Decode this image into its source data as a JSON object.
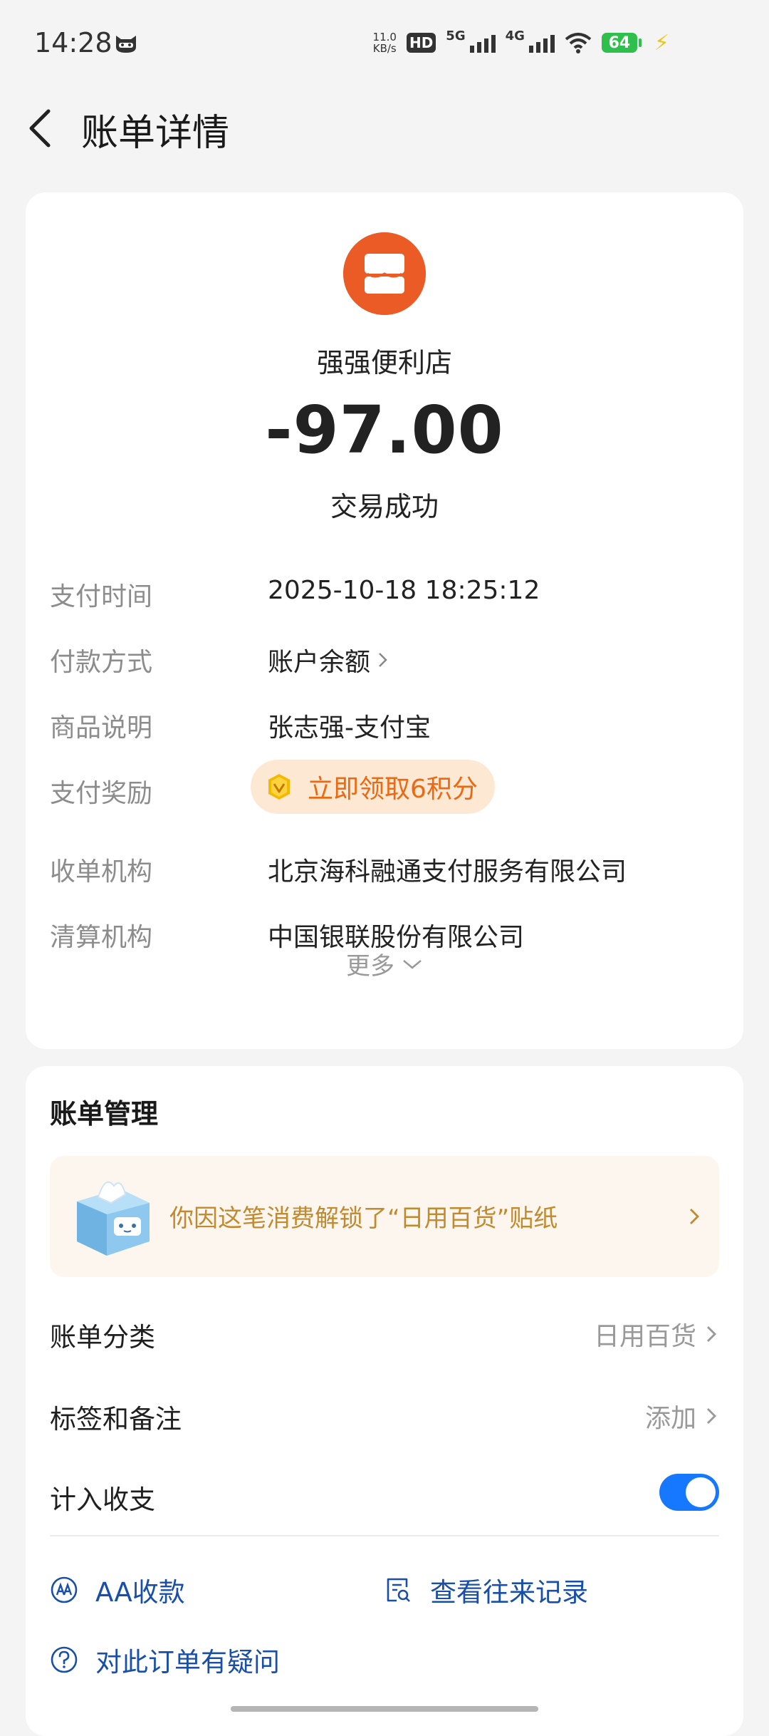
{
  "status_bar": {
    "time": "14:28",
    "net_speed_value": "11.0",
    "net_speed_unit": "KB/s",
    "hd_label": "HD",
    "signal_1_label": "5G",
    "signal_2_label": "4G",
    "battery_level": "64",
    "icons": [
      "cat-icon",
      "hd-icon",
      "signal-5g-icon",
      "signal-4g-icon",
      "wifi-icon",
      "battery-icon",
      "charging-bolt-icon"
    ]
  },
  "header": {
    "title": "账单详情"
  },
  "bill": {
    "merchant_name": "强强便利店",
    "amount": "-97.00",
    "status": "交易成功",
    "accent_color": "#eb5b25",
    "details": {
      "pay_time_label": "支付时间",
      "pay_time_value": "2025-10-18 18:25:12",
      "pay_method_label": "付款方式",
      "pay_method_value": "账户余额",
      "item_desc_label": "商品说明",
      "item_desc_value": "张志强-支付宝",
      "reward_label": "支付奖励",
      "reward_value": "立即领取6积分",
      "acquirer_label": "收单机构",
      "acquirer_value": "北京海科融通支付服务有限公司",
      "clearing_label": "清算机构",
      "clearing_value": "中国银联股份有限公司"
    },
    "more_label": "更多"
  },
  "manage": {
    "title": "账单管理",
    "sticker_banner_text": "你因这笔消费解锁了“日用百货”贴纸",
    "category_label": "账单分类",
    "category_value": "日用百货",
    "tags_label": "标签和备注",
    "tags_value": "添加",
    "include_label": "计入收支",
    "include_on": true,
    "toggle_color": "#1677ff",
    "aa_label": "AA收款",
    "history_label": "查看往来记录",
    "question_label": "对此订单有疑问"
  }
}
